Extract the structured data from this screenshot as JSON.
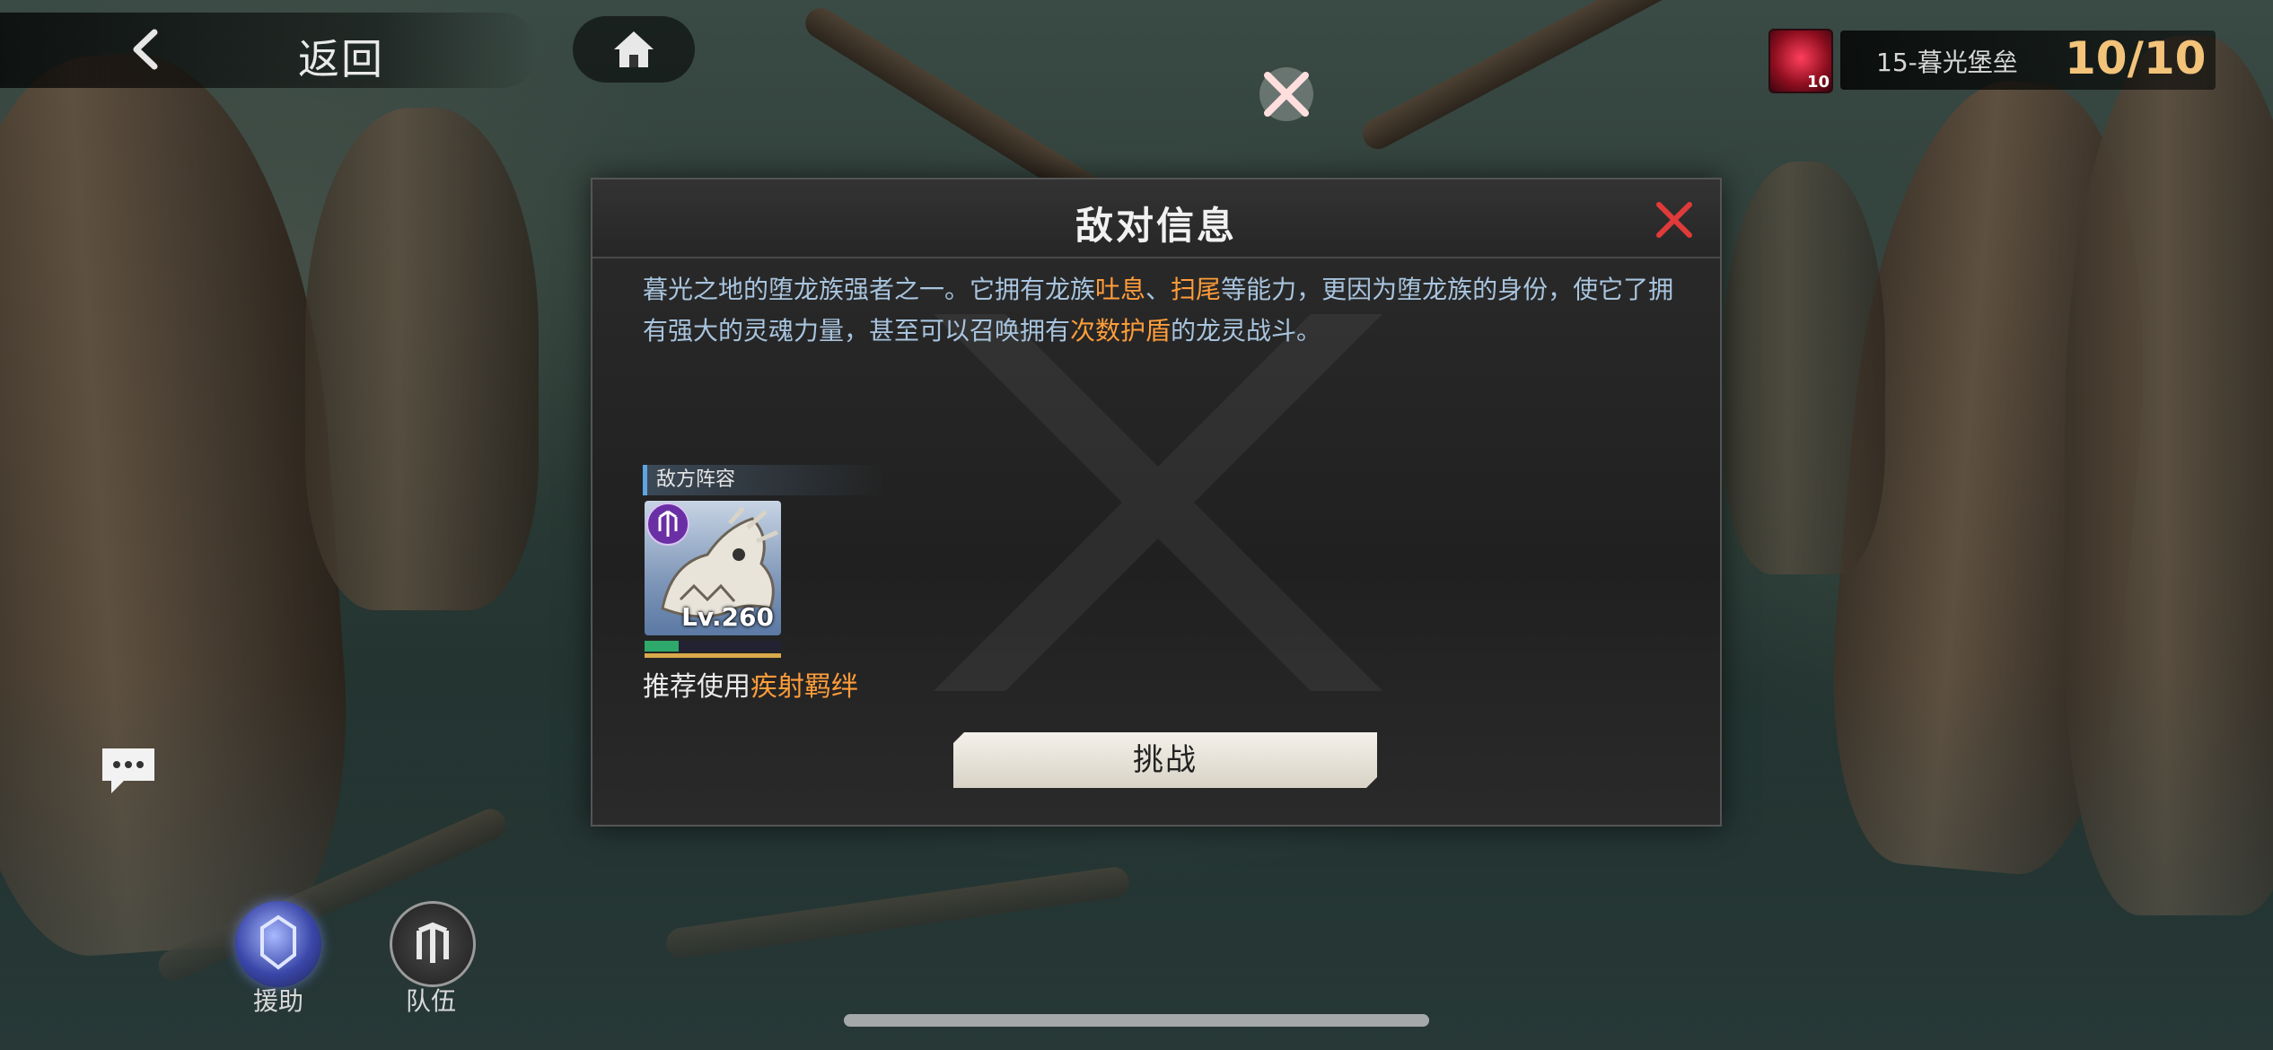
{
  "nav": {
    "back_label": "返回"
  },
  "stage": {
    "badge_number": "10",
    "name": "15-暮光堡垒",
    "count": "10/10"
  },
  "dialog": {
    "title": "敌对信息",
    "description": [
      {
        "text": "暮光之地的堕龙族强者之一。它拥有龙族",
        "highlight": false
      },
      {
        "text": "吐息",
        "highlight": true
      },
      {
        "text": "、",
        "highlight": false
      },
      {
        "text": "扫尾",
        "highlight": true
      },
      {
        "text": "等能力，更因为堕龙族的身份，使它了拥有强大的灵魂力量，甚至可以召唤拥有",
        "highlight": false
      },
      {
        "text": "次数护盾",
        "highlight": true
      },
      {
        "text": "的龙灵战斗。",
        "highlight": false
      }
    ],
    "lineup_label": "敌方阵容",
    "enemy": {
      "level": "Lv.260",
      "hp_fraction": 0.25
    },
    "recommend_prefix": "推荐使用",
    "recommend_highlight": "疾射羁绊",
    "challenge_label": "挑战"
  },
  "bottom": {
    "aid_label": "援助",
    "team_label": "队伍"
  },
  "colors": {
    "highlight": "#ff9d3b",
    "description": "#a8c4de",
    "stage_count": "#f3c37a",
    "close": "#e03a3a"
  }
}
